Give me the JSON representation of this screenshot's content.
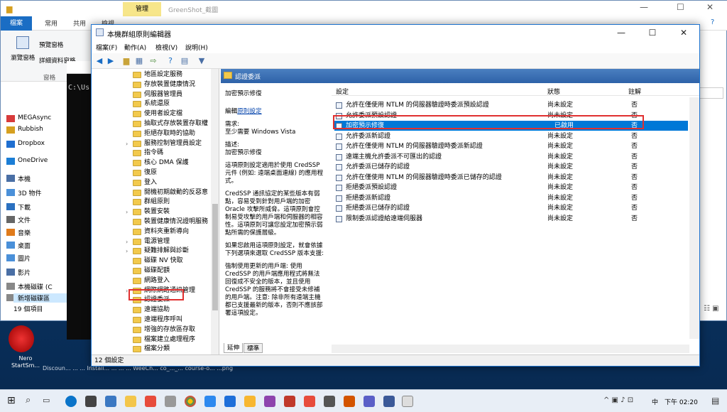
{
  "explorer": {
    "title": "GreenShot_截圖",
    "manage_tab": "管理",
    "tabs": [
      "檔案",
      "常用",
      "共用",
      "檢視"
    ],
    "ribbon": {
      "preview": "預覽窗格",
      "details": "詳細資料窗格",
      "nav": "瀏覽窗格",
      "group": "窗格"
    },
    "path_hint": "C:\\Us",
    "nav_items": [
      "MEGAsync",
      "Rubbish",
      "Dropbox",
      "OneDrive",
      "本機",
      "3D 物件",
      "下載",
      "文件",
      "音樂",
      "桌面",
      "圖片",
      "影片",
      "本機磁碟 (C",
      "新增磁碟區"
    ],
    "status": "19 個項目"
  },
  "gpe": {
    "title": "本機群組原則編輯器",
    "menu": [
      "檔案(F)",
      "動作(A)",
      "檢視(V)",
      "說明(H)"
    ],
    "tree": [
      {
        "label": "地區設定服務",
        "exp": false
      },
      {
        "label": "存放裝置健康情況",
        "exp": false
      },
      {
        "label": "伺服器管理員",
        "exp": false
      },
      {
        "label": "系統還原",
        "exp": false
      },
      {
        "label": "使用者設定檔",
        "exp": false
      },
      {
        "label": "抽取式存放裝置存取權",
        "exp": false
      },
      {
        "label": "拒絕存取時的協助",
        "exp": false
      },
      {
        "label": "服務控制管理員設定",
        "exp": true
      },
      {
        "label": "指令碼",
        "exp": false
      },
      {
        "label": "核心 DMA 保護",
        "exp": false
      },
      {
        "label": "復原",
        "exp": false
      },
      {
        "label": "登入",
        "exp": false
      },
      {
        "label": "開機初期啟動的反惡意",
        "exp": false
      },
      {
        "label": "群組原則",
        "exp": false
      },
      {
        "label": "裝置安裝",
        "exp": true
      },
      {
        "label": "裝置健康情況證明服務",
        "exp": false
      },
      {
        "label": "資料夾重新導向",
        "exp": false
      },
      {
        "label": "電源管理",
        "exp": true
      },
      {
        "label": "疑難排解與診斷",
        "exp": true
      },
      {
        "label": "磁碟 NV 快取",
        "exp": false
      },
      {
        "label": "磁碟配額",
        "exp": false
      },
      {
        "label": "網路登入",
        "exp": false
      },
      {
        "label": "網際網路通訊管理",
        "exp": true
      },
      {
        "label": "認證委派",
        "exp": false
      },
      {
        "label": "遠端協助",
        "exp": false
      },
      {
        "label": "遠端程序呼叫",
        "exp": false
      },
      {
        "label": "增強的存放區存取",
        "exp": false
      },
      {
        "label": "檔案建立處理程序",
        "exp": false
      },
      {
        "label": "檔案分類",
        "exp": false
      }
    ],
    "detail_header": "認證委派",
    "desc": {
      "title": "加密預示修復",
      "edit_prefix": "編輯",
      "edit_link": "原則設定",
      "req_label": "需求:",
      "req_value": "至少需要 Windows Vista",
      "desc_label": "描述:",
      "desc_value": "加密預示修復",
      "p1": "這項原則設定適用於使用 CredSSP 元件 (例如: 遠端桌面連線) 的應用程式。",
      "p2": "CredSSP 通訊協定的某些版本有弱點，容易受到針對用戶端的加密 Oracle 攻擊所威脅。這項原則會控制易受攻擊的用戶端和伺服器的相容性。這項原則可讓您設定加密預示弱點所需的保護層級。",
      "p3": "如果您啟用這項原則設定，就會依據下列選項來選取 CredSSP 版本支援:",
      "p4": "強制使用更新的用戶端: 使用 CredSSP 的用戶端應用程式將無法回復成不安全的版本，並且使用 CredSSP 的服務將不會接受未修補的用戶端。注意: 除非所有遠端主機都已支援最新的版本，否則不應該部署這項設定。"
    },
    "columns": {
      "setting": "設定",
      "state": "狀態",
      "note": "註解"
    },
    "rows": [
      {
        "name": "允許在僅使用 NTLM 的伺服器驗證時委派預設認證",
        "state": "尚未設定",
        "note": "否"
      },
      {
        "name": "允許委派預設認證",
        "state": "尚未設定",
        "note": "否"
      },
      {
        "name": "加密預示修復",
        "state": "已啟用",
        "note": "否"
      },
      {
        "name": "允許委派新認證",
        "state": "尚未設定",
        "note": "否"
      },
      {
        "name": "允許在僅使用 NTLM 的伺服器驗證時委派新認證",
        "state": "尚未設定",
        "note": "否"
      },
      {
        "name": "遠端主機允許委派不可匯出的認證",
        "state": "尚未設定",
        "note": "否"
      },
      {
        "name": "允許委派已儲存的認證",
        "state": "尚未設定",
        "note": "否"
      },
      {
        "name": "允許在僅使用 NTLM 的伺服器驗證時委派已儲存的認證",
        "state": "尚未設定",
        "note": "否"
      },
      {
        "name": "拒絕委派預設認證",
        "state": "尚未設定",
        "note": "否"
      },
      {
        "name": "拒絕委派新認證",
        "state": "尚未設定",
        "note": "否"
      },
      {
        "name": "拒絕委派已儲存的認證",
        "state": "尚未設定",
        "note": "否"
      },
      {
        "name": "限制委派認證給遠端伺服器",
        "state": "尚未設定",
        "note": "否"
      }
    ],
    "tabs": [
      "延伸",
      "標準"
    ],
    "status": "12 個設定"
  },
  "desktop": {
    "nero": "Nero StartSm...",
    "labels": "Discoun...     ...     ...     Install...     ...     ...     ...     WeeCh...     co_..._...     course-o...     ...png"
  },
  "taskbar": {
    "ime": "中",
    "time": "下午 02:20"
  },
  "colors": {
    "accent": "#0078d7",
    "highlight_box": "#e03030"
  }
}
